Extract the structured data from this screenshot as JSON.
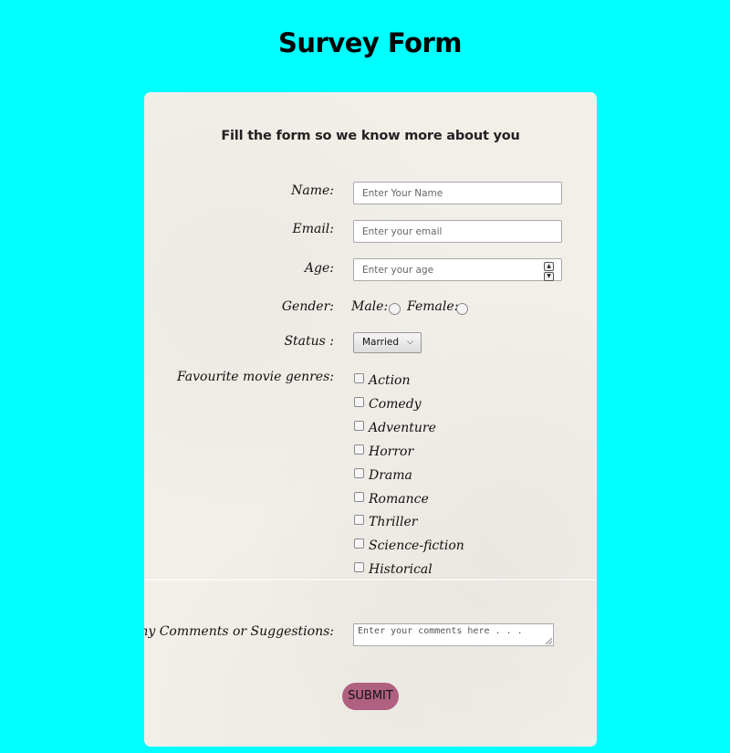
{
  "page": {
    "title": "Survey Form",
    "background": "#00ffff"
  },
  "form": {
    "subtitle": "Fill the form so we know more about you",
    "name": {
      "label": "Name:",
      "placeholder": "Enter Your Name"
    },
    "email": {
      "label": "Email:",
      "placeholder": "Enter your email"
    },
    "age": {
      "label": "Age:",
      "placeholder": "Enter your age"
    },
    "gender": {
      "label": "Gender:",
      "options": [
        "Male:",
        "Female:"
      ]
    },
    "status": {
      "label": "Status :",
      "selected": "Married"
    },
    "genres": {
      "label": "Favourite movie genres:",
      "options": [
        "Action",
        "Comedy",
        "Adventure",
        "Horror",
        "Drama",
        "Romance",
        "Thriller",
        "Science-fiction",
        "Historical"
      ]
    },
    "comments": {
      "label": "Any Comments or Suggestions:",
      "placeholder": "Enter your comments here . . ."
    },
    "submit_label": "SUBMIT",
    "accent_color": "#b06080"
  }
}
